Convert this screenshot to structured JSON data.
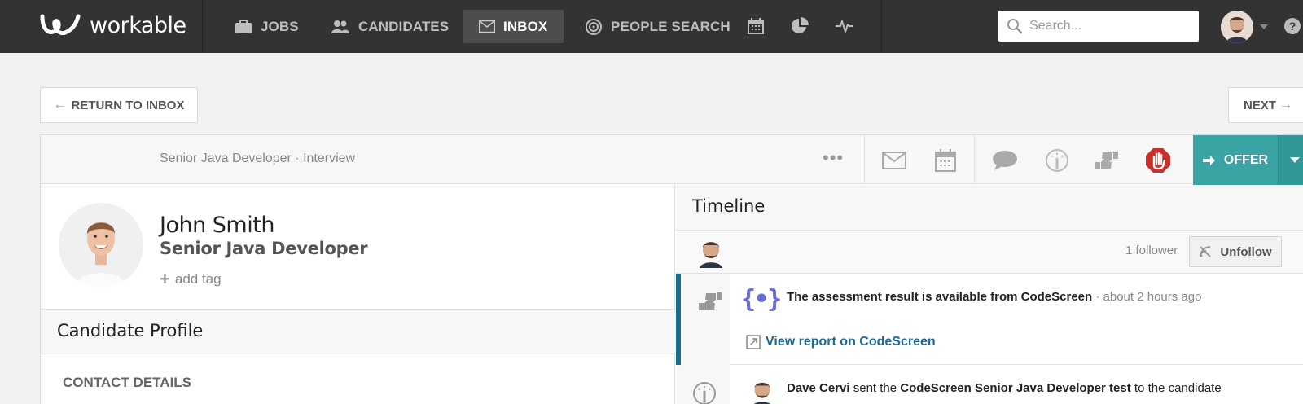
{
  "app": {
    "logo_text": "workable"
  },
  "nav": {
    "items": [
      {
        "label": "JOBS",
        "icon": "briefcase-icon"
      },
      {
        "label": "CANDIDATES",
        "icon": "people-icon"
      },
      {
        "label": "INBOX",
        "icon": "envelope-icon",
        "active": true
      },
      {
        "label": "PEOPLE SEARCH",
        "icon": "target-icon"
      }
    ],
    "icon_buttons": [
      "calendar-icon",
      "pie-chart-icon",
      "activity-icon"
    ],
    "search": {
      "placeholder": "Search..."
    },
    "help_label": "?"
  },
  "toolbar": {
    "return_label": "RETURN TO INBOX",
    "return_arrow": "←",
    "next_label": "NEXT",
    "next_arrow": "→"
  },
  "card": {
    "subtitle": "Senior Java Developer · Interview",
    "more_label": "•••",
    "actions": [
      "email-icon",
      "calendar-icon",
      "comment-icon",
      "evaluate-icon",
      "thumbs-icon",
      "disqualify-icon"
    ],
    "offer_label": "OFFER"
  },
  "candidate": {
    "name": "John Smith",
    "role": "Senior Java Developer",
    "add_tag_label": "add tag",
    "add_tag_symbol": "+"
  },
  "profile": {
    "section_title": "Candidate Profile",
    "contact_heading": "CONTACT DETAILS"
  },
  "timeline": {
    "title": "Timeline",
    "follower_count": "1 follower",
    "unfollow_label": "Unfollow",
    "events": [
      {
        "logo": "{•}",
        "title": "The assessment result is available from CodeScreen",
        "time": "· about 2 hours ago",
        "link": "View report on CodeScreen"
      },
      {
        "actor": "Dave Cervi",
        "verb": "sent the",
        "object": "CodeScreen Senior Java Developer test",
        "suffix": "to the candidate"
      }
    ]
  },
  "colors": {
    "nav_bg": "#333333",
    "offer_bg": "#3aa3a3",
    "link": "#1e6a96",
    "timeline_accent": "#1c6d94",
    "codescreen_purple": "#6a6fd4",
    "disqualify_red": "#c9302c"
  }
}
